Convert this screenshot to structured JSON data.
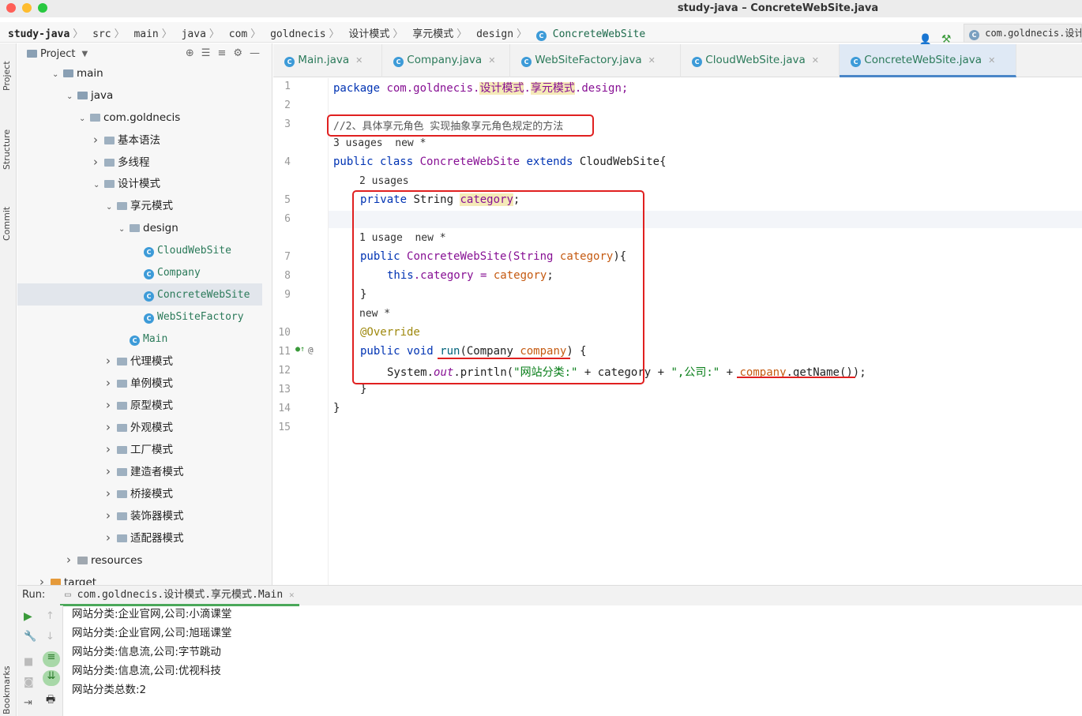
{
  "window": {
    "title": "study-java – ConcreteWebSite.java"
  },
  "colors": {
    "close": "#ff5f57",
    "minimize": "#febc2e",
    "zoom": "#28c840",
    "accent": "#4a86c8",
    "annotation_red": "#e02020"
  },
  "nav": {
    "crumbs": [
      "study-java",
      "src",
      "main",
      "java",
      "com",
      "goldnecis",
      "设计模式",
      "享元模式",
      "design",
      "ConcreteWebSite"
    ],
    "right_pkg": "com.goldnecis.设计模"
  },
  "left_strip": {
    "tabs": [
      "Project",
      "Structure",
      "Commit",
      "Bookmarks"
    ]
  },
  "project": {
    "title": "Project",
    "tree": [
      {
        "label": "main",
        "arrow": "v",
        "kind": "folder"
      },
      {
        "label": "java",
        "arrow": "v",
        "kind": "folder"
      },
      {
        "label": "com.goldnecis",
        "arrow": "v",
        "kind": "pkg"
      },
      {
        "label": "基本语法",
        "arrow": ">",
        "kind": "pkg"
      },
      {
        "label": "多线程",
        "arrow": ">",
        "kind": "pkg"
      },
      {
        "label": "设计模式",
        "arrow": "v",
        "kind": "pkg"
      },
      {
        "label": "享元模式",
        "arrow": "v",
        "kind": "pkg"
      },
      {
        "label": "design",
        "arrow": "v",
        "kind": "pkg"
      },
      {
        "label": "CloudWebSite",
        "arrow": "",
        "kind": "class"
      },
      {
        "label": "Company",
        "arrow": "",
        "kind": "class"
      },
      {
        "label": "ConcreteWebSite",
        "arrow": "",
        "kind": "class"
      },
      {
        "label": "WebSiteFactory",
        "arrow": "",
        "kind": "class"
      },
      {
        "label": "Main",
        "arrow": "",
        "kind": "class"
      },
      {
        "label": "代理模式",
        "arrow": ">",
        "kind": "pkg"
      },
      {
        "label": "单例模式",
        "arrow": ">",
        "kind": "pkg"
      },
      {
        "label": "原型模式",
        "arrow": ">",
        "kind": "pkg"
      },
      {
        "label": "外观模式",
        "arrow": ">",
        "kind": "pkg"
      },
      {
        "label": "工厂模式",
        "arrow": ">",
        "kind": "pkg"
      },
      {
        "label": "建造者模式",
        "arrow": ">",
        "kind": "pkg"
      },
      {
        "label": "桥接模式",
        "arrow": ">",
        "kind": "pkg"
      },
      {
        "label": "装饰器模式",
        "arrow": ">",
        "kind": "pkg"
      },
      {
        "label": "适配器模式",
        "arrow": ">",
        "kind": "pkg"
      },
      {
        "label": "resources",
        "arrow": ">",
        "kind": "res"
      },
      {
        "label": "target",
        "arrow": ">",
        "kind": "target"
      }
    ]
  },
  "tabs": [
    {
      "label": "Main.java"
    },
    {
      "label": "Company.java"
    },
    {
      "label": "WebSiteFactory.java"
    },
    {
      "label": "CloudWebSite.java"
    },
    {
      "label": "ConcreteWebSite.java"
    }
  ],
  "editor": {
    "line_numbers": [
      "1",
      "2",
      "3",
      "4",
      "5",
      "6",
      "7",
      "8",
      "9",
      "10",
      "11",
      "12",
      "13",
      "14",
      "15"
    ],
    "hints": {
      "h1": "3 usages  new *",
      "h2": "2 usages",
      "h3": "1 usage  new *",
      "h4": "new *"
    },
    "code": {
      "l1_kw": "package",
      "l1_pkg": "com.goldnecis.",
      "l1_p2": "设计模式",
      "l1_dot": ".",
      "l1_p3": "享元模式",
      "l1_end": ".design;",
      "l3": "//2、具体享元角色 实现抽象享元角色规定的方法",
      "l4_kw": "public class",
      "l4_name": "ConcreteWebSite",
      "l4_ext": "extends",
      "l4_rest": "CloudWebSite{",
      "l5_kw": "private",
      "l5_type": "String",
      "l5_field": "category",
      "l5_end": ";",
      "l7_kw": "public",
      "l7_name": "ConcreteWebSite(String",
      "l7_param": "category",
      "l7_end": "){",
      "l8_this": "this",
      "l8_field": ".category = ",
      "l8_param": "category",
      "l8_end": ";",
      "l9": "}",
      "l10": "@Override",
      "l11_kw": "public void",
      "l11_fn": "run",
      "l11_type": "(Company ",
      "l11_param": "company",
      "l11_end": ") {",
      "l12_a": "System.",
      "l12_out": "out",
      "l12_b": ".println(",
      "l12_s1": "\"网站分类:\"",
      "l12_c": " + category + ",
      "l12_s2": "\",公司:\"",
      "l12_d": " + ",
      "l12_comp": "company",
      "l12_e": ".getName());",
      "l13": "}",
      "l14": "}"
    }
  },
  "run": {
    "label": "Run:",
    "config": "com.goldnecis.设计模式.享元模式.Main",
    "output": [
      "网站分类:企业官网,公司:小滴课堂",
      "网站分类:企业官网,公司:旭瑶课堂",
      "网站分类:信息流,公司:字节跳动",
      "网站分类:信息流,公司:优视科技",
      "网站分类总数:2"
    ]
  }
}
